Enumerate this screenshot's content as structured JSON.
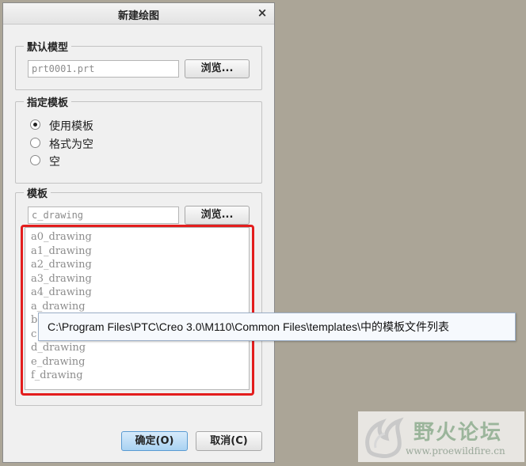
{
  "dialog": {
    "title": "新建绘图",
    "close_glyph": "×"
  },
  "default_model": {
    "legend": "默认模型",
    "value": "prt0001.prt",
    "browse_label": "浏览..."
  },
  "template_mode": {
    "legend": "指定模板",
    "options": [
      {
        "label": "使用模板",
        "selected": true
      },
      {
        "label": "格式为空",
        "selected": false
      },
      {
        "label": "空",
        "selected": false
      }
    ]
  },
  "template": {
    "legend": "模板",
    "value": "c_drawing",
    "browse_label": "浏览...",
    "items": [
      "a0_drawing",
      "a1_drawing",
      "a2_drawing",
      "a3_drawing",
      "a4_drawing",
      "a_drawing",
      "b",
      "c",
      "d_drawing",
      "e_drawing",
      "f_drawing"
    ]
  },
  "tooltip": {
    "text": "C:\\Program Files\\PTC\\Creo 3.0\\M110\\Common Files\\templates\\中的模板文件列表"
  },
  "footer": {
    "ok_label": "确定(O)",
    "cancel_label": "取消(C)"
  },
  "watermark": {
    "title": "野火论坛",
    "url": "www.proewildfire.cn"
  },
  "colors": {
    "highlight": "#e31d1d",
    "ok_button": "#a9d2f2"
  }
}
